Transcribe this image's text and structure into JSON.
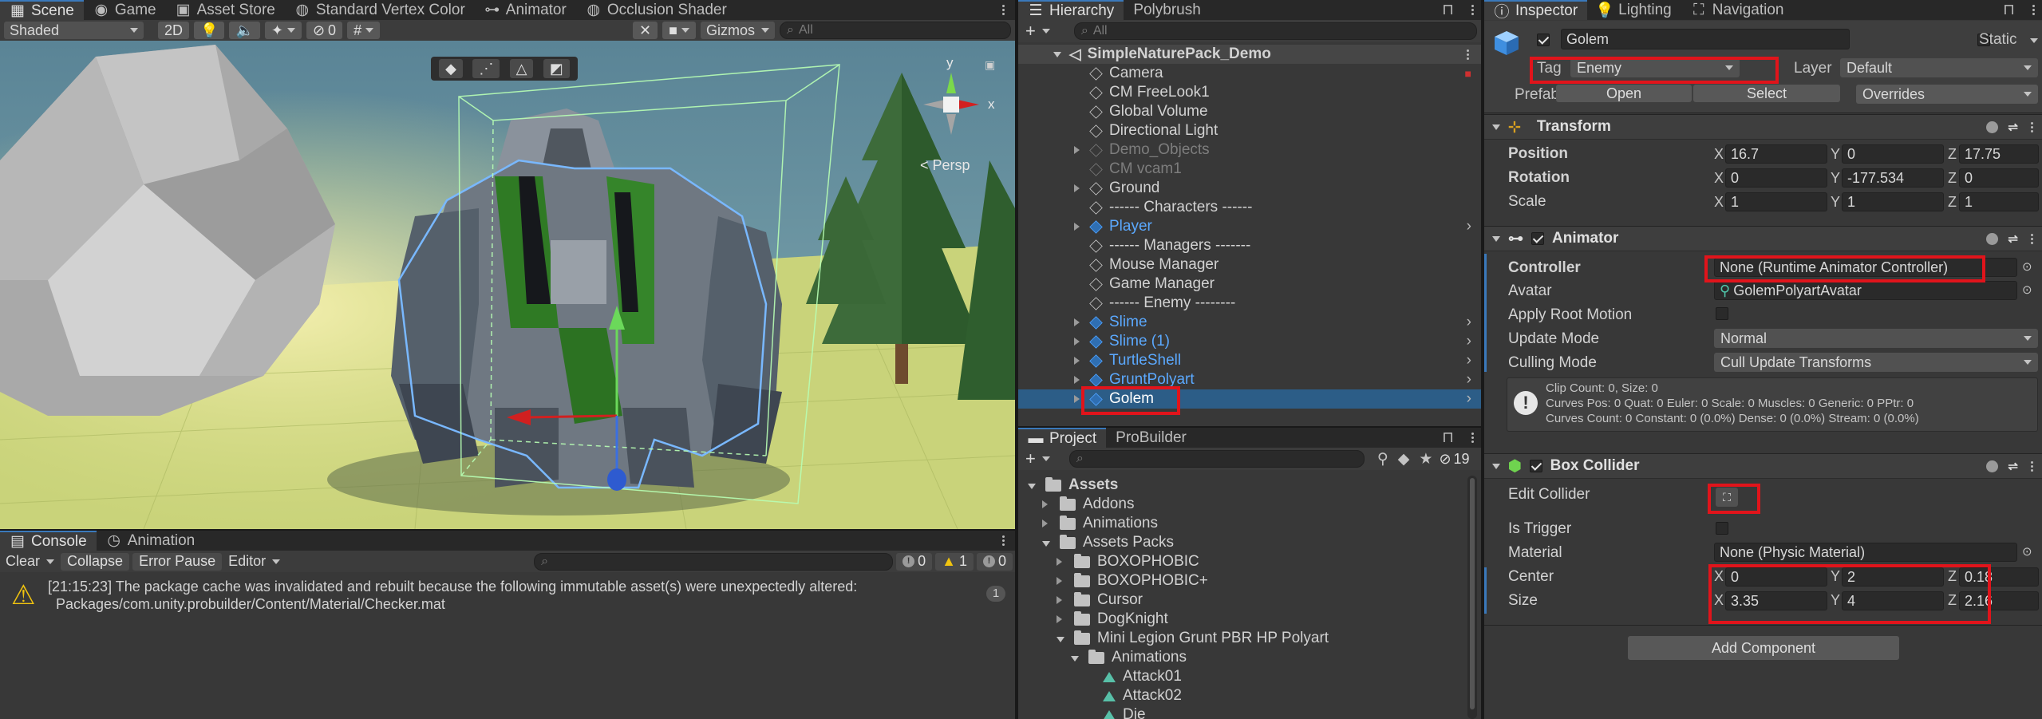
{
  "scene_window": {
    "tabs": [
      {
        "label": "Scene",
        "icon": "scene-grid-icon",
        "active": true
      },
      {
        "label": "Game",
        "icon": "game-controller-icon"
      },
      {
        "label": "Asset Store",
        "icon": "shopping-bag-icon"
      },
      {
        "label": "Standard Vertex Color",
        "icon": "shader-icon"
      },
      {
        "label": "Animator",
        "icon": "animator-icon"
      },
      {
        "label": "Occlusion Shader",
        "icon": "shader-icon"
      }
    ],
    "shading_mode": "Shaded",
    "mode_2d": "2D",
    "hidden_count": "0",
    "gizmos_label": "Gizmos",
    "search_placeholder": "All",
    "persp_label": "< Persp",
    "axis_y": "y",
    "axis_x": "x"
  },
  "console": {
    "tabs": [
      {
        "label": "Console",
        "icon": "console-icon",
        "active": true
      },
      {
        "label": "Animation",
        "icon": "animation-clock-icon"
      }
    ],
    "toolbar": {
      "clear": "Clear",
      "collapse": "Collapse",
      "error_pause": "Error Pause",
      "editor": "Editor"
    },
    "counts": {
      "logs": "0",
      "warnings": "1",
      "errors": "0"
    },
    "messages": [
      {
        "line1": "[21:15:23] The package cache was invalidated and rebuilt because the following immutable asset(s) were unexpectedly altered:",
        "line2": "Packages/com.unity.probuilder/Content/Material/Checker.mat",
        "count": "1"
      }
    ]
  },
  "hierarchy": {
    "tabs": [
      {
        "label": "Hierarchy",
        "active": true
      },
      {
        "label": "Polybrush"
      }
    ],
    "search_placeholder": "All",
    "scene_name": "SimpleNaturePack_Demo",
    "items": [
      {
        "label": "Camera",
        "color": "normal",
        "arrow": false
      },
      {
        "label": "CM FreeLook1",
        "color": "normal",
        "arrow": false
      },
      {
        "label": "Global Volume",
        "color": "normal",
        "arrow": false
      },
      {
        "label": "Directional Light",
        "color": "normal",
        "arrow": false
      },
      {
        "label": "Demo_Objects",
        "color": "dim",
        "arrow": true
      },
      {
        "label": "CM vcam1",
        "color": "dim",
        "arrow": false
      },
      {
        "label": "Ground",
        "color": "normal",
        "arrow": true
      },
      {
        "label": "------ Characters ------",
        "color": "normal",
        "arrow": false
      },
      {
        "label": "Player",
        "color": "prefab",
        "arrow": true
      },
      {
        "label": "------ Managers -------",
        "color": "normal",
        "arrow": false
      },
      {
        "label": "Mouse Manager",
        "color": "normal",
        "arrow": false
      },
      {
        "label": "Game Manager",
        "color": "normal",
        "arrow": false
      },
      {
        "label": "------ Enemy --------",
        "color": "normal",
        "arrow": false
      },
      {
        "label": "Slime",
        "color": "prefab",
        "arrow": true
      },
      {
        "label": "Slime (1)",
        "color": "prefab",
        "arrow": true
      },
      {
        "label": "TurtleShell",
        "color": "prefab",
        "arrow": true
      },
      {
        "label": "GruntPolyart",
        "color": "prefab",
        "arrow": true
      },
      {
        "label": "Golem",
        "color": "prefab",
        "arrow": true,
        "selected": true
      }
    ]
  },
  "project": {
    "tabs": [
      {
        "label": "Project",
        "active": true
      },
      {
        "label": "ProBuilder"
      }
    ],
    "hidden_count": "19",
    "items": [
      {
        "label": "Assets",
        "depth": 0,
        "open": true,
        "bold": true,
        "type": "folder"
      },
      {
        "label": "Addons",
        "depth": 1,
        "open": false,
        "type": "folder"
      },
      {
        "label": "Animations",
        "depth": 1,
        "open": false,
        "type": "folder"
      },
      {
        "label": "Assets Packs",
        "depth": 1,
        "open": true,
        "type": "folder"
      },
      {
        "label": "BOXOPHOBIC",
        "depth": 2,
        "open": false,
        "type": "folder"
      },
      {
        "label": "BOXOPHOBIC+",
        "depth": 2,
        "open": false,
        "type": "folder"
      },
      {
        "label": "Cursor",
        "depth": 2,
        "open": false,
        "type": "folder"
      },
      {
        "label": "DogKnight",
        "depth": 2,
        "open": false,
        "type": "folder"
      },
      {
        "label": "Mini Legion Grunt PBR HP Polyart",
        "depth": 2,
        "open": true,
        "type": "folder"
      },
      {
        "label": "Animations",
        "depth": 3,
        "open": true,
        "type": "folder"
      },
      {
        "label": "Attack01",
        "depth": 4,
        "type": "anim"
      },
      {
        "label": "Attack02",
        "depth": 4,
        "type": "anim"
      },
      {
        "label": "Die",
        "depth": 4,
        "type": "anim"
      }
    ]
  },
  "inspector": {
    "tabs": [
      {
        "label": "Inspector",
        "icon": "info-icon",
        "active": true
      },
      {
        "label": "Lighting",
        "icon": "lightbulb-icon"
      },
      {
        "label": "Navigation",
        "icon": "navigation-icon"
      }
    ],
    "object_name": "Golem",
    "static_label": "Static",
    "tag_label": "Tag",
    "tag_value": "Enemy",
    "layer_label": "Layer",
    "layer_value": "Default",
    "prefab_label": "Prefab",
    "prefab_open": "Open",
    "prefab_select": "Select",
    "prefab_overrides": "Overrides",
    "transform": {
      "title": "Transform",
      "position": {
        "label": "Position",
        "x": "16.7",
        "y": "0",
        "z": "17.75"
      },
      "rotation": {
        "label": "Rotation",
        "x": "0",
        "y": "-177.534",
        "z": "0"
      },
      "scale": {
        "label": "Scale",
        "x": "1",
        "y": "1",
        "z": "1"
      }
    },
    "animator": {
      "title": "Animator",
      "controller_label": "Controller",
      "controller_value": "None (Runtime Animator Controller)",
      "avatar_label": "Avatar",
      "avatar_value": "GolemPolyartAvatar",
      "apply_root_motion_label": "Apply Root Motion",
      "update_mode_label": "Update Mode",
      "update_mode_value": "Normal",
      "culling_mode_label": "Culling Mode",
      "culling_mode_value": "Cull Update Transforms",
      "info_line1": "Clip Count: 0, Size: 0",
      "info_line2": "Curves Pos: 0 Quat: 0 Euler: 0 Scale: 0 Muscles: 0 Generic: 0 PPtr: 0",
      "info_line3": "Curves Count: 0 Constant: 0 (0.0%) Dense: 0 (0.0%) Stream: 0 (0.0%)"
    },
    "box_collider": {
      "title": "Box Collider",
      "edit_collider_label": "Edit Collider",
      "is_trigger_label": "Is Trigger",
      "material_label": "Material",
      "material_value": "None (Physic Material)",
      "center": {
        "label": "Center",
        "x": "0",
        "y": "2",
        "z": "0.18"
      },
      "size": {
        "label": "Size",
        "x": "3.35",
        "y": "4",
        "z": "2.16"
      }
    },
    "add_component": "Add Component"
  },
  "colors": {
    "highlight_red": "#e1141b",
    "selection_blue": "#2c5d87",
    "prefab_blue": "#5ba9ff",
    "panel_bg": "#383838"
  }
}
